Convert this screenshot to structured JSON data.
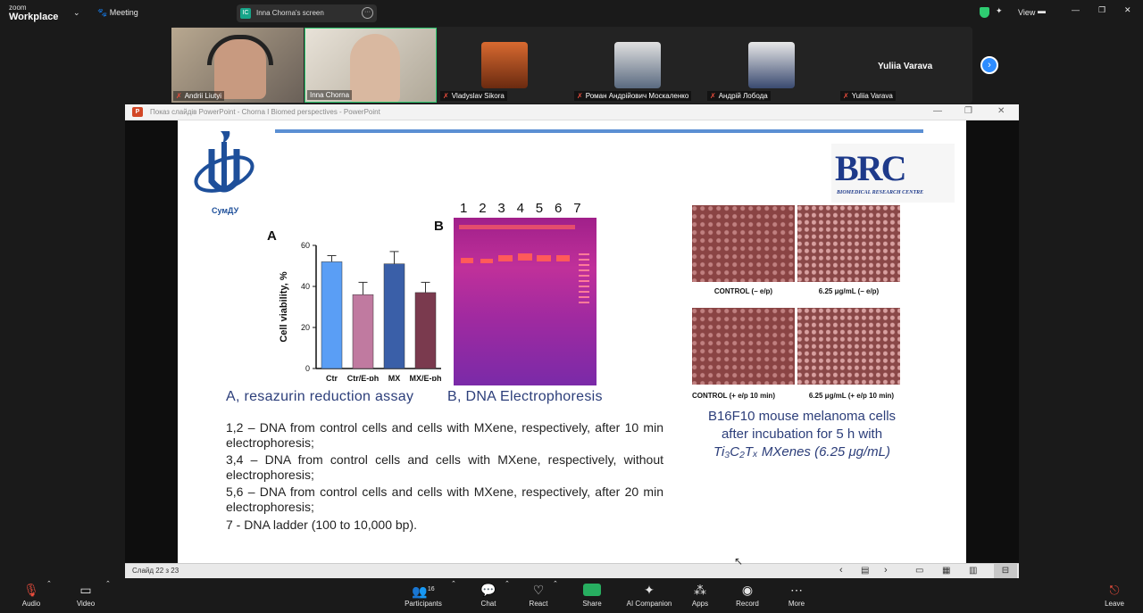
{
  "app": {
    "zoom_small": "zoom",
    "zoom_big": "Workplace",
    "meeting_label": "Meeting",
    "view_label": "View"
  },
  "share_pill": {
    "initials": "IC",
    "label": "Inna Chorna's screen"
  },
  "participants": [
    {
      "name": "Andrii Liutyi"
    },
    {
      "name": "Inna Chorna"
    },
    {
      "name": "Vladyslav Sikora"
    },
    {
      "name": "Роман Андрійович Москаленко"
    },
    {
      "name": "Андрій Лобода"
    },
    {
      "name": "Yuliia Varava"
    }
  ],
  "yuliia_title": "Yuliia Varava",
  "ppt": {
    "window_title": "Показ слайдів PowerPoint  -  Chorna I Biomed perspectives - PowerPoint",
    "slide_counter": "Слайд 22 з 23"
  },
  "slide": {
    "logo_sumdu": "СумДУ",
    "brc_big": "BRC",
    "brc_small": "BIOMEDICAL RESEARCH CENTRE",
    "panel_a": "A",
    "panel_b": "B",
    "lanes": [
      "1",
      "2",
      "3",
      "4",
      "5",
      "6",
      "7"
    ],
    "caption_a": "A, resazurin reduction assay",
    "caption_b": "B, DNA Electrophoresis",
    "lines": [
      "1,2 – DNA from control cells and cells with MXene, respectively, after 10 min electrophoresis;",
      "3,4 – DNA from control cells and cells with MXene, respectively, without electrophoresis;",
      "5,6 – DNA from control cells and cells with MXene, respectively, after 20 min electrophoresis;",
      "7 - DNA ladder (100 to 10,000 bp)."
    ],
    "cell_labels": [
      "CONTROL (– e/p)",
      "6.25 μg/mL (– e/p)",
      "CONTROL (+ e/p 10 min)",
      "6.25 μg/mL (+ e/p 10 min)"
    ],
    "b16_line1": "B16F10 mouse melanoma cells",
    "b16_line2": "after incubation for 5 h with",
    "b16_line3": "Ti₃C₂Tₓ MXenes (6.25 μg/mL)"
  },
  "chart_data": {
    "type": "bar",
    "categories": [
      "Ctr",
      "Ctr/E-ph",
      "MX",
      "MX/E-ph"
    ],
    "values": [
      52,
      36,
      51,
      37
    ],
    "errors": [
      3,
      6,
      6,
      5
    ],
    "ylabel": "Cell viability, %",
    "ylim": [
      0,
      60
    ],
    "yticks": [
      0,
      20,
      40,
      60
    ],
    "colors": [
      "#5a9ef5",
      "#c07aa0",
      "#3a5fa8",
      "#7a3a4e"
    ]
  },
  "toolbar": [
    {
      "label": "Audio",
      "icon": "mic-off-icon"
    },
    {
      "label": "Video",
      "icon": "video-icon"
    },
    {
      "label": "Participants",
      "icon": "participants-icon",
      "count": "16"
    },
    {
      "label": "Chat",
      "icon": "chat-icon"
    },
    {
      "label": "React",
      "icon": "heart-icon"
    },
    {
      "label": "Share",
      "icon": "share-icon"
    },
    {
      "label": "AI Companion",
      "icon": "sparkle-icon"
    },
    {
      "label": "Apps",
      "icon": "apps-icon"
    },
    {
      "label": "Record",
      "icon": "record-icon"
    },
    {
      "label": "More",
      "icon": "more-icon"
    },
    {
      "label": "Leave",
      "icon": "leave-icon"
    }
  ]
}
